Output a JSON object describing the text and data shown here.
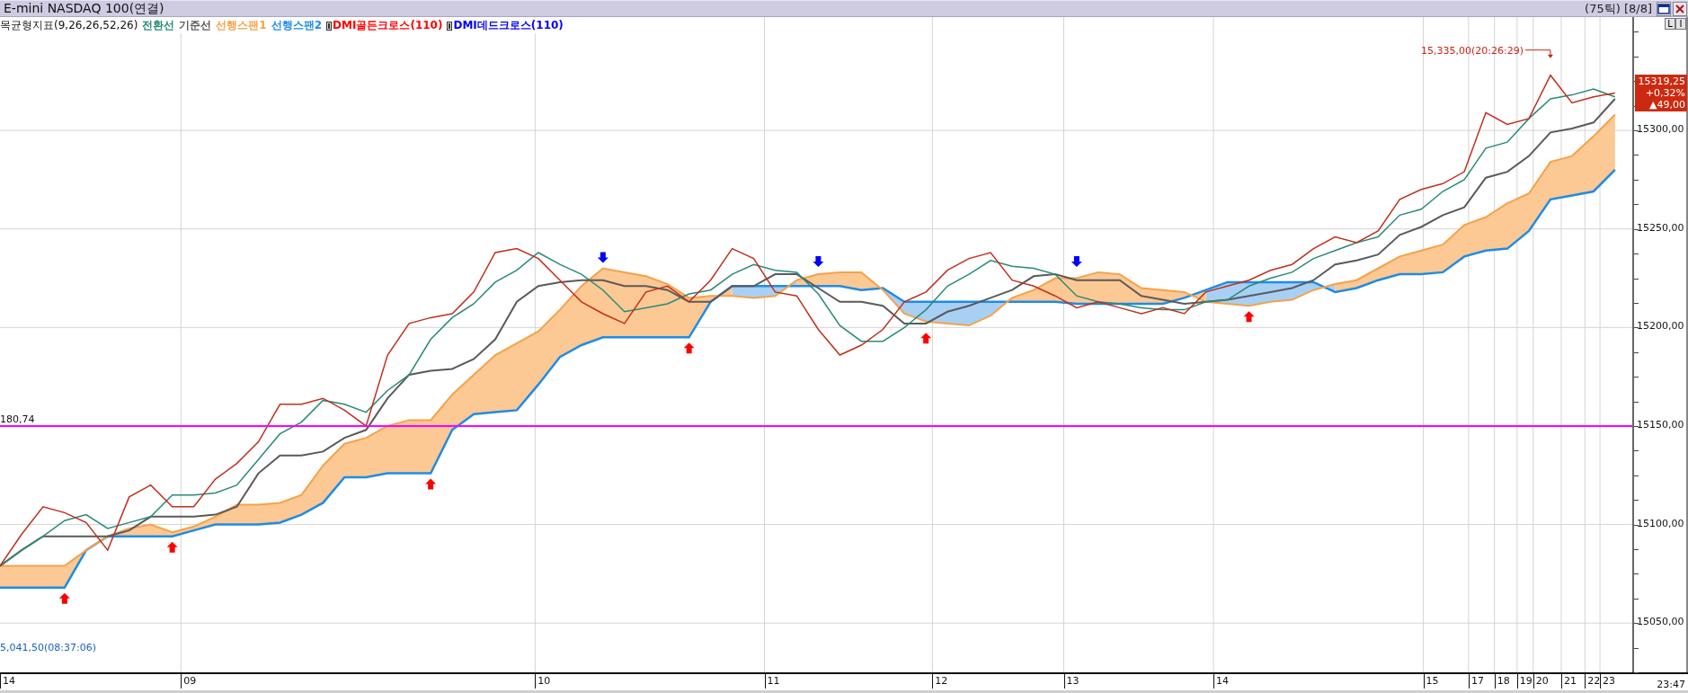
{
  "window": {
    "title": "E-mini NASDAQ 100(연결)",
    "info": "(75틱) [8/8]"
  },
  "toolbar_buttons": [
    "L",
    "I"
  ],
  "legend": {
    "title": "목균형지표(9,26,26,52,26)",
    "items": [
      {
        "label": "DMI골든크로스(110)",
        "kind": "golden",
        "color": "#ff0000"
      },
      {
        "label": "DMI데드크로스(110)",
        "kind": "dead",
        "color": "#0000ff"
      }
    ]
  },
  "chart_data": {
    "type": "line",
    "categories": [
      null,
      null,
      null,
      null,
      null,
      null,
      null,
      null,
      null,
      null,
      null,
      null,
      null,
      null,
      null,
      null,
      null,
      null,
      null,
      null,
      null,
      null,
      null,
      null,
      null,
      null,
      null,
      null,
      null,
      null,
      null,
      null,
      null,
      null,
      null,
      null,
      null,
      null,
      null,
      null,
      null,
      null,
      null,
      null,
      null,
      null,
      null,
      null,
      null,
      null,
      null,
      null,
      null,
      null,
      null,
      null,
      null,
      null,
      null,
      null,
      null,
      null,
      null,
      null,
      null,
      null,
      null,
      null,
      null,
      null,
      null,
      null,
      null,
      null,
      null,
      null
    ],
    "grid": true,
    "series": [
      {
        "color": "#c0301c",
        "values": [
          15079,
          15095,
          15109,
          15106,
          15101,
          15087,
          15114,
          15120,
          15109,
          15109,
          15123,
          15131,
          15142,
          15161,
          15161,
          15164,
          15158,
          15150,
          15186,
          15202,
          15205,
          15207,
          15218,
          15238,
          15240,
          15235,
          15224,
          15213,
          15207,
          15202,
          15218,
          15221,
          15213,
          15224,
          15240,
          15235,
          15218,
          15216,
          15199,
          15186,
          15191,
          15199,
          15213,
          15218,
          15229,
          15235,
          15238,
          15224,
          15221,
          15216,
          15210,
          15213,
          15210,
          15207,
          15210,
          15207,
          15218,
          15221,
          15224,
          15229,
          15232,
          15240,
          15246,
          15243,
          15249,
          15265,
          15270,
          15273,
          15279,
          15309,
          15303,
          15306,
          15328,
          15314,
          15317,
          15319
        ]
      },
      {
        "name": "전환선",
        "color": "#2a8a78",
        "values": [
          15079,
          15087,
          15094,
          15102,
          15105,
          15098,
          15101,
          15104,
          15115,
          15115,
          15116,
          15120,
          15133,
          15146,
          15152,
          15163,
          15161,
          15157,
          15168,
          15176,
          15194,
          15205,
          15212,
          15223,
          15229,
          15238,
          15232,
          15227,
          15219,
          15208,
          15210,
          15212,
          15217,
          15219,
          15227,
          15232,
          15229,
          15228,
          15217,
          15201,
          15193,
          15193,
          15200,
          15209,
          15221,
          15227,
          15234,
          15231,
          15230,
          15227,
          15216,
          15213,
          15212,
          15210,
          15209,
          15209,
          15213,
          15214,
          15221,
          15225,
          15228,
          15235,
          15239,
          15243,
          15246,
          15257,
          15260,
          15269,
          15275,
          15291,
          15294,
          15306,
          15316,
          15318,
          15321,
          15317
        ]
      },
      {
        "name": "기준선",
        "color": "#5a5a5a",
        "values": [
          15079,
          15087,
          15094,
          15094,
          15094,
          15094,
          15097,
          15104,
          15104,
          15104,
          15105,
          15109,
          15126,
          15135,
          15135,
          15137,
          15144,
          15148,
          15164,
          15176,
          15178,
          15179,
          15184,
          15194,
          15213,
          15221,
          15223,
          15224,
          15224,
          15221,
          15221,
          15219,
          15213,
          15213,
          15221,
          15221,
          15227,
          15227,
          15220,
          15213,
          15213,
          15211,
          15202,
          15202,
          15208,
          15211,
          15215,
          15219,
          15226,
          15227,
          15224,
          15224,
          15224,
          15216,
          15214,
          15212,
          15213,
          15214,
          15216,
          15218,
          15220,
          15224,
          15232,
          15234,
          15237,
          15247,
          15251,
          15257,
          15261,
          15276,
          15279,
          15287,
          15299,
          15301,
          15304,
          15316
        ]
      },
      {
        "name": "선행스팬1",
        "color": "#f5a24a",
        "values": [
          15079,
          15079,
          15079,
          15079,
          15087,
          15094,
          15098,
          15100,
          15096,
          15099,
          15104,
          15110,
          15110,
          15111,
          15115,
          15130,
          15141,
          15144,
          15150,
          15153,
          15153,
          15166,
          15176,
          15186,
          15192,
          15198,
          15209,
          15221,
          15230,
          15228,
          15226,
          15222,
          15215,
          15216,
          15216,
          15215,
          15216,
          15224,
          15227,
          15228,
          15228,
          15219,
          15207,
          15203,
          15202,
          15201,
          15206,
          15215,
          15219,
          15225,
          15225,
          15228,
          15227,
          15220,
          15219,
          15218,
          15213,
          15212,
          15211,
          15213,
          15214,
          15219,
          15222,
          15224,
          15230,
          15236,
          15239,
          15242,
          15252,
          15256,
          15263,
          15268,
          15284,
          15287,
          15297,
          15308
        ]
      },
      {
        "name": "선행스팬2",
        "color": "#1e8ce6",
        "values": [
          15068,
          15068,
          15068,
          15068,
          15087,
          15094,
          15094,
          15094,
          15094,
          15097,
          15100,
          15100,
          15100,
          15101,
          15105,
          15111,
          15124,
          15124,
          15126,
          15126,
          15126,
          15148,
          15156,
          15157,
          15158,
          15171,
          15185,
          15191,
          15195,
          15195,
          15195,
          15195,
          15195,
          15213,
          15221,
          15221,
          15221,
          15221,
          15221,
          15221,
          15219,
          15220,
          15213,
          15213,
          15213,
          15213,
          15213,
          15213,
          15213,
          15213,
          15212,
          15212,
          15212,
          15212,
          15212,
          15215,
          15219,
          15223,
          15223,
          15223,
          15223,
          15223,
          15218,
          15220,
          15224,
          15227,
          15227,
          15228,
          15236,
          15239,
          15240,
          15249,
          15265,
          15267,
          15269,
          15280
        ]
      }
    ],
    "ylim": [
      15025,
      15357.5
    ],
    "yticks": [
      {
        "value": 15050,
        "label": "15050,00"
      },
      {
        "value": 15100,
        "label": "15100,00"
      },
      {
        "value": 15150,
        "label": "15150,00"
      },
      {
        "value": 15200,
        "label": "15200,00"
      },
      {
        "value": 15250,
        "label": "15250,00"
      },
      {
        "value": 15300,
        "label": "15300,00"
      }
    ],
    "ref_lines": [
      {
        "axis": "y",
        "value": 15150,
        "color": "#ff00ff"
      }
    ],
    "annotations": [
      "15,335,00(20:26:29)",
      "5,041,50(08:37:06)"
    ]
  },
  "ref_line_text": "180,74",
  "x_axis": {
    "labels": [
      "14",
      "09",
      "10",
      "11",
      "12",
      "13",
      "14",
      "15",
      "17",
      "18",
      "19",
      "20",
      "21",
      "22",
      "23"
    ],
    "end_label": "23:47"
  },
  "price_badge": {
    "lines": [
      "15319,25",
      "+0,32%",
      "▲49,00"
    ]
  }
}
